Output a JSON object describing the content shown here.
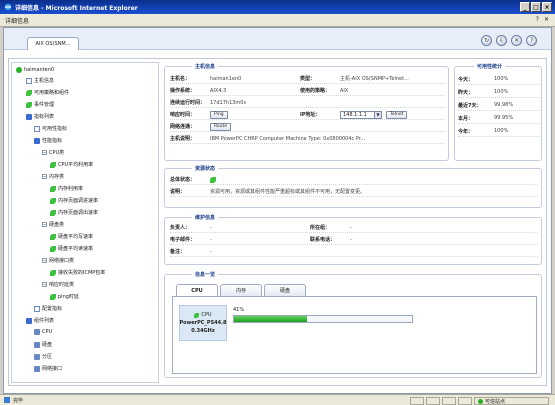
{
  "window": {
    "title": "详细信息 - Microsoft Internet Explorer"
  },
  "commandbar": {
    "title": "详细信息",
    "right_icons": [
      "?",
      "✕"
    ]
  },
  "host_tab": {
    "label": "AIX OS(SNM..."
  },
  "toolbar_icons": [
    "refresh-icon",
    "export-icon",
    "close-circle-icon",
    "help-icon"
  ],
  "tree": {
    "root": "haimanten0",
    "items": [
      {
        "label": "主机信息",
        "indent": 1,
        "icon": "box"
      },
      {
        "label": "可用策略和组件",
        "indent": 1,
        "icon": "leaf"
      },
      {
        "label": "事件管理",
        "indent": 1,
        "icon": "leaf"
      },
      {
        "label": "指标列表",
        "indent": 1,
        "icon": "folder"
      },
      {
        "label": "可用性指标",
        "indent": 2,
        "icon": "box"
      },
      {
        "label": "性能指标",
        "indent": 2,
        "icon": "folder"
      },
      {
        "label": "CPU类",
        "indent": 3,
        "icon": "none"
      },
      {
        "label": "CPU平均利用率",
        "indent": 4,
        "icon": "leaf"
      },
      {
        "label": "内存类",
        "indent": 3,
        "icon": "none"
      },
      {
        "label": "内存利用率",
        "indent": 4,
        "icon": "leaf"
      },
      {
        "label": "内存页面调进速率",
        "indent": 4,
        "icon": "leaf"
      },
      {
        "label": "内存页面调出速率",
        "indent": 4,
        "icon": "leaf"
      },
      {
        "label": "硬盘类",
        "indent": 3,
        "icon": "none"
      },
      {
        "label": "硬盘平均写速率",
        "indent": 4,
        "icon": "leaf"
      },
      {
        "label": "硬盘平均读速率",
        "indent": 4,
        "icon": "leaf"
      },
      {
        "label": "网络接口类",
        "indent": 3,
        "icon": "none"
      },
      {
        "label": "接收失败的ICMP包率",
        "indent": 4,
        "icon": "leaf"
      },
      {
        "label": "响应时延类",
        "indent": 3,
        "icon": "none"
      },
      {
        "label": "ping时延",
        "indent": 4,
        "icon": "leaf"
      },
      {
        "label": "配置指标",
        "indent": 2,
        "icon": "box"
      },
      {
        "label": "组件列表",
        "indent": 1,
        "icon": "folder"
      },
      {
        "label": "CPU",
        "indent": 2,
        "icon": "pc"
      },
      {
        "label": "硬盘",
        "indent": 2,
        "icon": "pc"
      },
      {
        "label": "分区",
        "indent": 2,
        "icon": "pc"
      },
      {
        "label": "网络接口",
        "indent": 2,
        "icon": "pc"
      }
    ]
  },
  "host_info": {
    "title": "主机信息",
    "hostname_label": "主机名：",
    "hostname": "haiman1en0",
    "type_label": "类型：",
    "type": "主机-AIX OS(SNMP+Telnet...",
    "os_label": "操作系统：",
    "os": "AIX4.3",
    "policy_label": "使用的策略：",
    "policy": "AIX",
    "uptime_label": "连续运行时间：",
    "uptime": "17d17h13m0s",
    "response_label": "响应时间：",
    "ping_btn": "Ping",
    "ip_label": "IP地址：",
    "ip": "148.1.1.1",
    "telnet_btn": "Telnet",
    "route_label": "网络连通：",
    "route_btn": "Route",
    "desc_label": "主机说明：",
    "desc": "IBM PowerPC CHRP Computer Machine Type: 0x0800004c Pr..."
  },
  "availability": {
    "title": "可用性统计",
    "rows": [
      {
        "label": "今天：",
        "value": "100%"
      },
      {
        "label": "昨天：",
        "value": "100%"
      },
      {
        "label": "最近7天：",
        "value": "99.98%"
      },
      {
        "label": "本月：",
        "value": "99.95%"
      },
      {
        "label": "今年：",
        "value": "100%"
      }
    ]
  },
  "resource_status": {
    "title": "资源状态",
    "overall_label": "总体状态：",
    "desc_label": "说明：",
    "desc": "资源可用，资源或其组件性能严重超标或其组件不可用，无配置变更。"
  },
  "maintenance": {
    "title": "维护信息",
    "owner_label": "负责人：",
    "owner": "-",
    "location_label": "所在组：",
    "location": "-",
    "email_label": "电子邮件：",
    "email": "-",
    "phone_label": "联系电话：",
    "phone": "-",
    "note_label": "备注：",
    "note": "-"
  },
  "overview": {
    "title": "信息一览",
    "tabs": [
      "CPU",
      "内存",
      "硬盘"
    ],
    "cpu_name": "CPU",
    "cpu_model": "PowerPC_PS44.8",
    "cpu_freq": "0.34GHz",
    "usage_text": "41%",
    "usage": 0.41
  },
  "status": {
    "left": "完毕",
    "zone": "可信站点"
  }
}
